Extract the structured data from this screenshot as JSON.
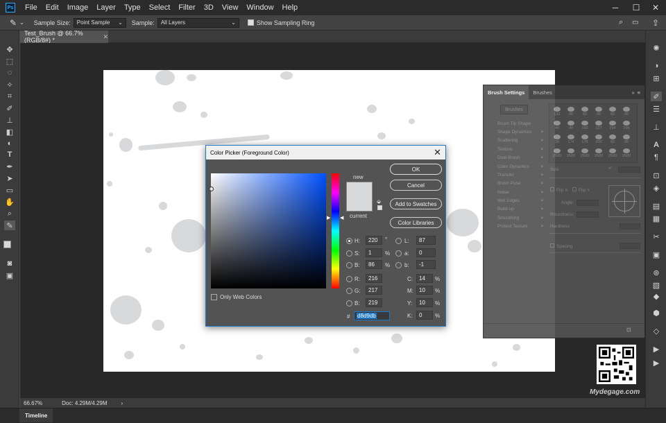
{
  "app": {
    "logo_text": "Ps",
    "menu": [
      "File",
      "Edit",
      "Image",
      "Layer",
      "Type",
      "Select",
      "Filter",
      "3D",
      "View",
      "Window",
      "Help"
    ]
  },
  "window_controls": {
    "minimize": "─",
    "maximize": "☐",
    "close": "✕"
  },
  "options_bar": {
    "sample_size_label": "Sample Size:",
    "sample_size_value": "Point Sample",
    "sample_label": "Sample:",
    "sample_value": "All Layers",
    "show_ring_label": "Show Sampling Ring"
  },
  "document": {
    "tab_title": "Test_Brush @ 66.7% (RGB/8#) *"
  },
  "status": {
    "zoom": "66.67%",
    "doc_info": "Doc: 4.29M/4.29M"
  },
  "timeline": {
    "label": "Timeline"
  },
  "brush_panel": {
    "tabs": [
      "Brush Settings",
      "Brushes"
    ],
    "brushes_button": "Brushes",
    "options": [
      "Brush Tip Shape",
      "Shape Dynamics",
      "Scattering",
      "Texture",
      "Dual Brush",
      "Color Dynamics",
      "Transfer",
      "Brush Pose",
      "Noise",
      "Wet Edges",
      "Build-up",
      "Smoothing",
      "Protect Texture"
    ],
    "presets": [
      "132",
      "60",
      "60",
      "60",
      "60",
      "60",
      "40",
      "40",
      "150",
      "127",
      "294",
      "296",
      "30",
      "174",
      "175",
      "300",
      "60",
      "90",
      "2500",
      "2500",
      "2500",
      "2500",
      "2500",
      "2500"
    ],
    "size_label": "Size",
    "flip_x": "Flip X",
    "flip_y": "Flip Y",
    "angle_label": "Angle:",
    "roundness_label": "Roundness:",
    "hardness_label": "Hardness",
    "spacing_label": "Spacing"
  },
  "color_picker": {
    "title": "Color Picker (Foreground Color)",
    "ok": "OK",
    "cancel": "Cancel",
    "add_to_swatches": "Add to Swatches",
    "color_libraries": "Color Libraries",
    "new_label": "new",
    "current_label": "current",
    "only_web_colors": "Only Web Colors",
    "new_color": "#d8d9db",
    "current_color": "#d8d9db",
    "hsb": {
      "H": {
        "label": "H:",
        "value": "220",
        "unit": "°"
      },
      "S": {
        "label": "S:",
        "value": "1",
        "unit": "%"
      },
      "B": {
        "label": "B:",
        "value": "86",
        "unit": "%"
      }
    },
    "rgb": {
      "R": {
        "label": "R:",
        "value": "216"
      },
      "G": {
        "label": "G:",
        "value": "217"
      },
      "B": {
        "label": "B:",
        "value": "219"
      }
    },
    "lab": {
      "L": {
        "label": "L:",
        "value": "87"
      },
      "a": {
        "label": "a:",
        "value": "0"
      },
      "b": {
        "label": "b:",
        "value": "-1"
      }
    },
    "cmyk": {
      "C": {
        "label": "C:",
        "value": "14",
        "unit": "%"
      },
      "M": {
        "label": "M:",
        "value": "10",
        "unit": "%"
      },
      "Y": {
        "label": "Y:",
        "value": "10",
        "unit": "%"
      },
      "K": {
        "label": "K:",
        "value": "0",
        "unit": "%"
      }
    },
    "hex_label": "#",
    "hex_value": "d8d9db"
  },
  "watermark": "Mydegage.com"
}
